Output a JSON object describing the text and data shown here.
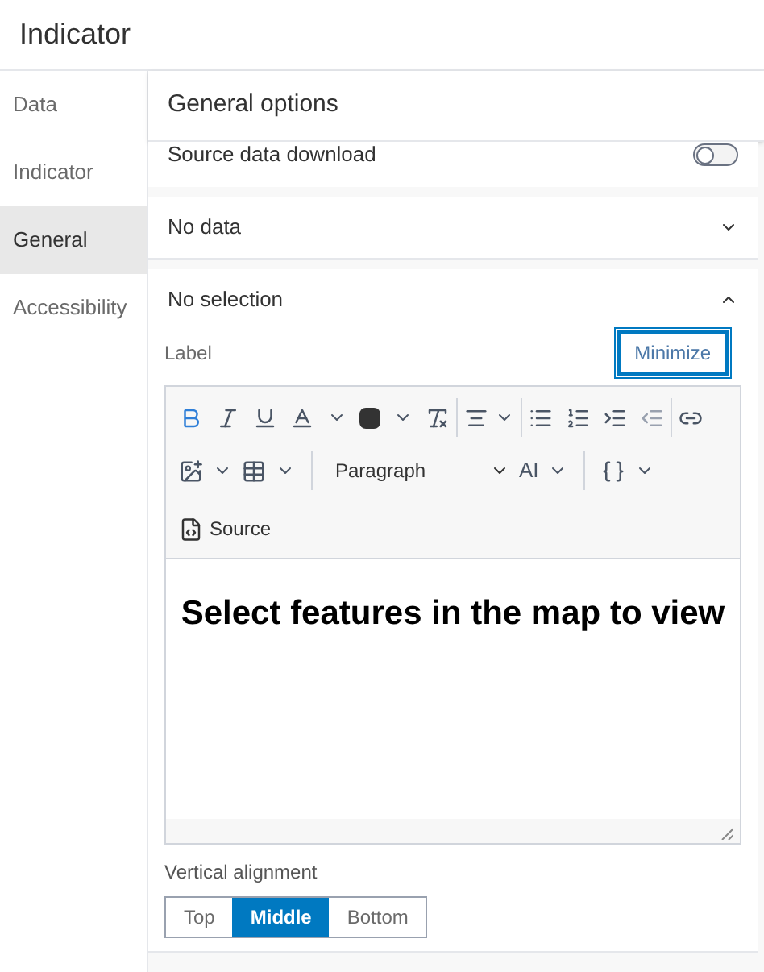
{
  "window": {
    "title": "Indicator"
  },
  "sidebar": {
    "items": [
      {
        "label": "Data",
        "selected": false
      },
      {
        "label": "Indicator",
        "selected": false
      },
      {
        "label": "General",
        "selected": true
      },
      {
        "label": "Accessibility",
        "selected": false
      }
    ]
  },
  "panel": {
    "title": "General options",
    "toggle_row": {
      "label": "Source data download",
      "on": false
    },
    "sections": [
      {
        "title": "No data",
        "expanded": false
      },
      {
        "title": "No selection",
        "expanded": true
      }
    ],
    "label": {
      "text": "Label",
      "button": "Minimize"
    },
    "editor": {
      "format": "Paragraph",
      "ai": "AI",
      "source": "Source",
      "content": "Select features in the map to view"
    },
    "alignment": {
      "label": "Vertical alignment",
      "options": [
        {
          "label": "Top",
          "selected": false
        },
        {
          "label": "Middle",
          "selected": true
        },
        {
          "label": "Bottom",
          "selected": false
        }
      ]
    }
  }
}
